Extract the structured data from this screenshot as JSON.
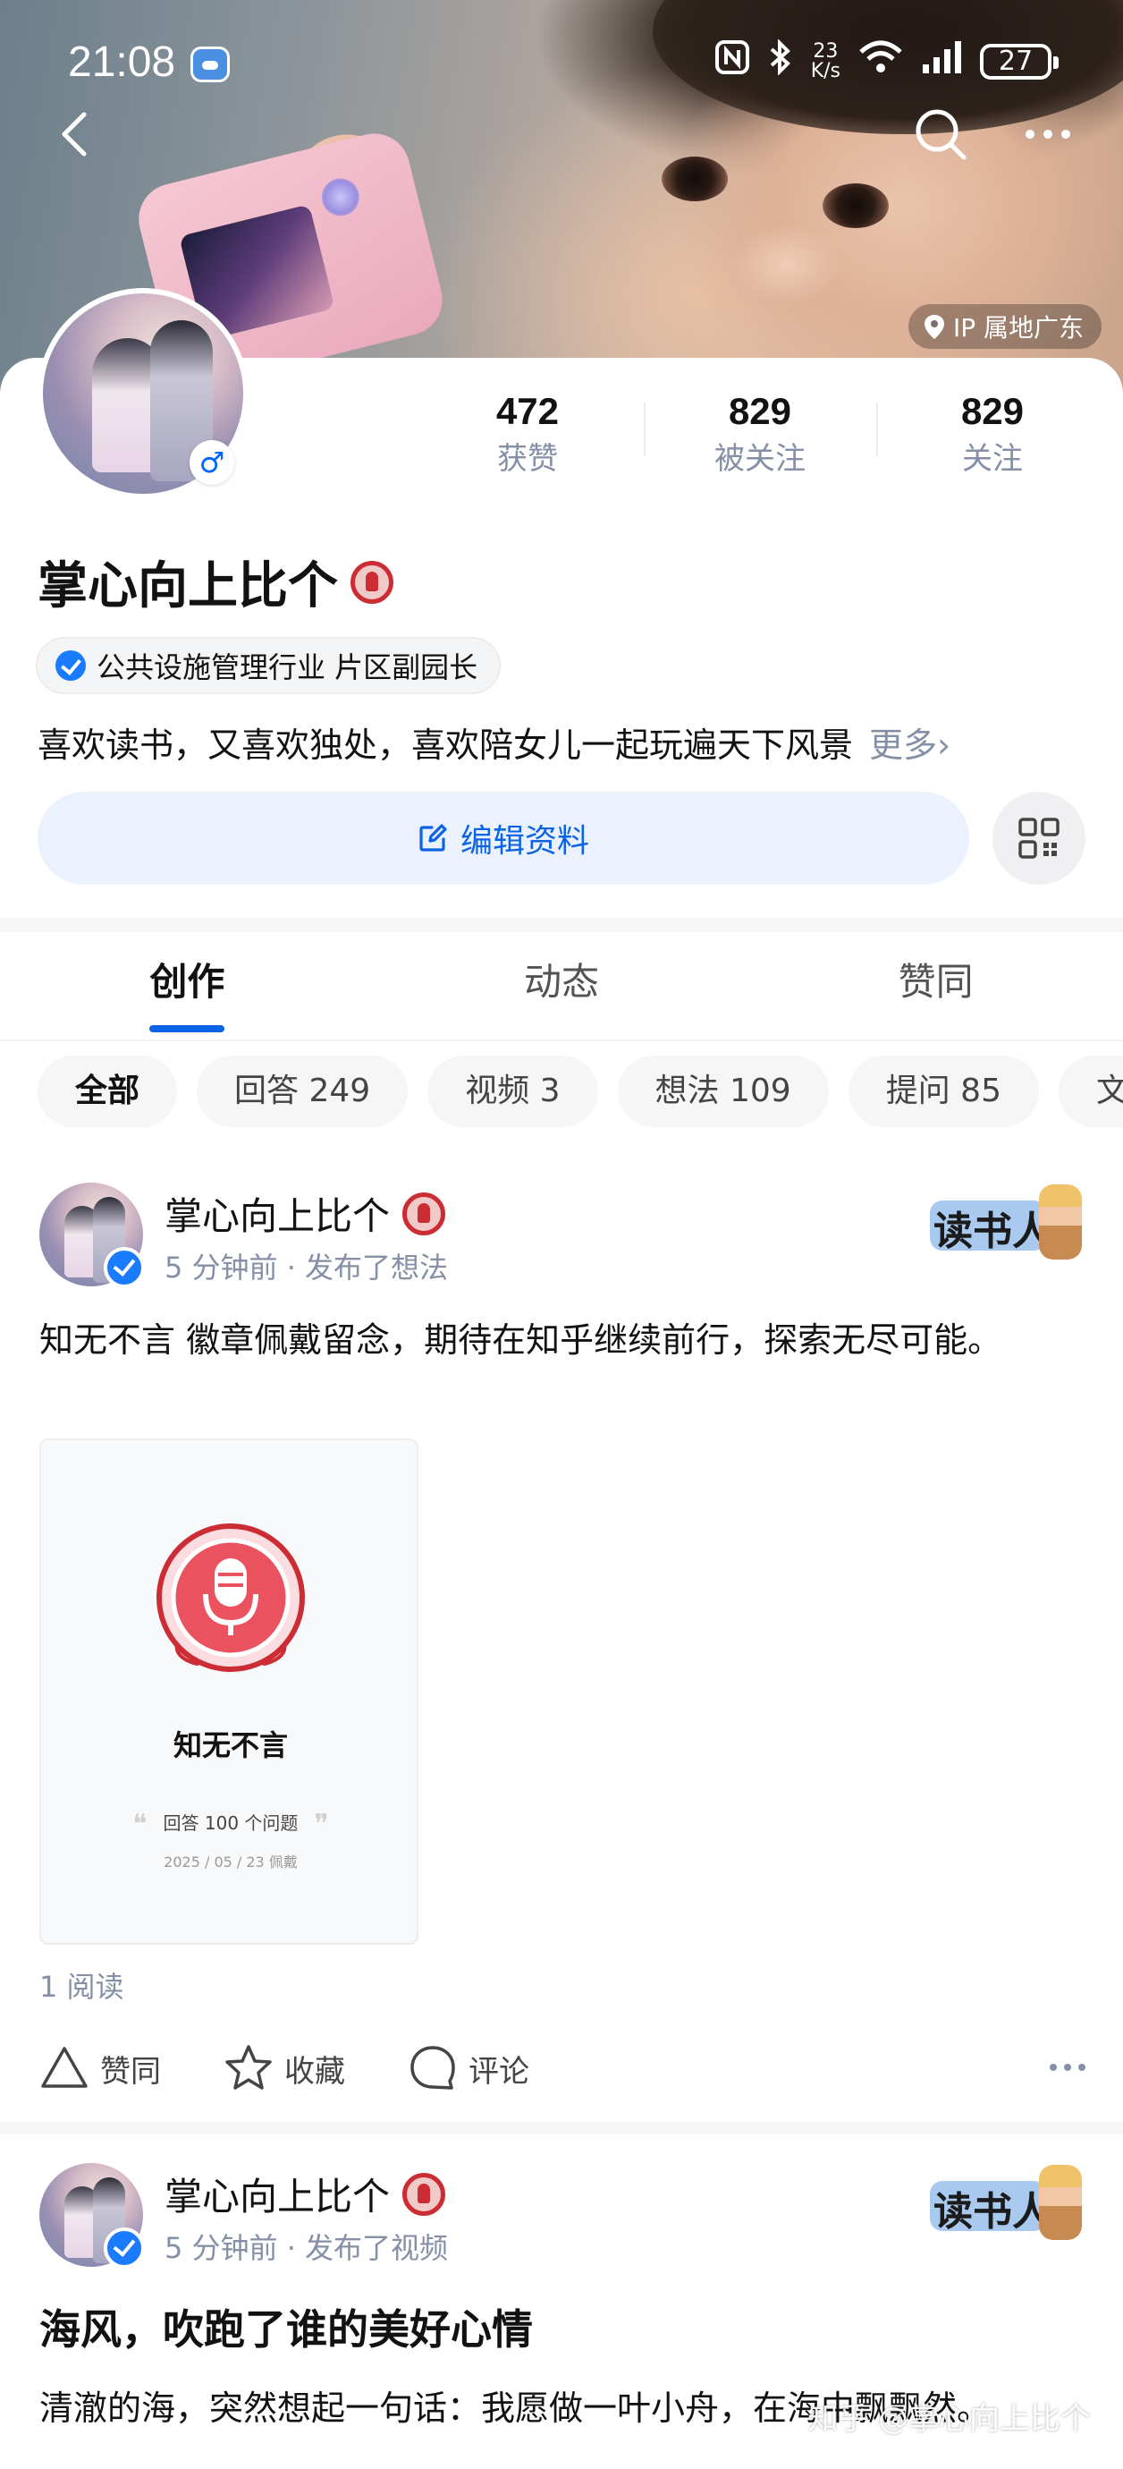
{
  "status_bar": {
    "time": "21:08",
    "speed_value": "23",
    "speed_unit": "K/s",
    "battery": "27"
  },
  "cover": {
    "ip_location": "IP 属地广东"
  },
  "profile": {
    "stats": [
      {
        "value": "472",
        "label": "获赞"
      },
      {
        "value": "829",
        "label": "被关注"
      },
      {
        "value": "829",
        "label": "关注"
      }
    ],
    "name": "掌心向上比个",
    "gender_symbol": "♂",
    "tag": "公共设施管理行业 片区副园长",
    "bio": "喜欢读书，又喜欢独处，喜欢陪女儿一起玩遍天下风景",
    "bio_more": "更多›",
    "edit_button": "编辑资料"
  },
  "tabs": [
    {
      "label": "创作",
      "active": true
    },
    {
      "label": "动态",
      "active": false
    },
    {
      "label": "赞同",
      "active": false
    }
  ],
  "filters": [
    {
      "label": "全部",
      "active": true
    },
    {
      "label": "回答 249"
    },
    {
      "label": "视频 3"
    },
    {
      "label": "想法 109"
    },
    {
      "label": "提问 85"
    },
    {
      "label": "文"
    }
  ],
  "posts": [
    {
      "author": "掌心向上比个",
      "meta": "5 分钟前 · 发布了想法",
      "reader_badge": "读书人",
      "text": "知无不言 徽章佩戴留念，期待在知乎继续前行，探索无尽可能。",
      "badge_card": {
        "name": "知无不言",
        "sub": "回答 100 个问题",
        "date": "2025 / 05 / 23 佩戴"
      },
      "reads": "1  阅读",
      "actions": {
        "upvote": "赞同",
        "favorite": "收藏",
        "comment": "评论"
      }
    },
    {
      "author": "掌心向上比个",
      "meta": "5 分钟前 · 发布了视频",
      "reader_badge": "读书人",
      "title": "海风，吹跑了谁的美好心情",
      "text": "清澈的海，突然想起一句话：我愿做一叶小舟，在海中飘飘然。"
    }
  ],
  "watermark": "知乎 @掌心向上比个",
  "colors": {
    "accent": "#0c63e4",
    "edit_button_bg": "#ebf2fd",
    "muted_text": "#8590a6",
    "medal_red": "#cc2c33",
    "verify_blue": "#1a7bff"
  }
}
